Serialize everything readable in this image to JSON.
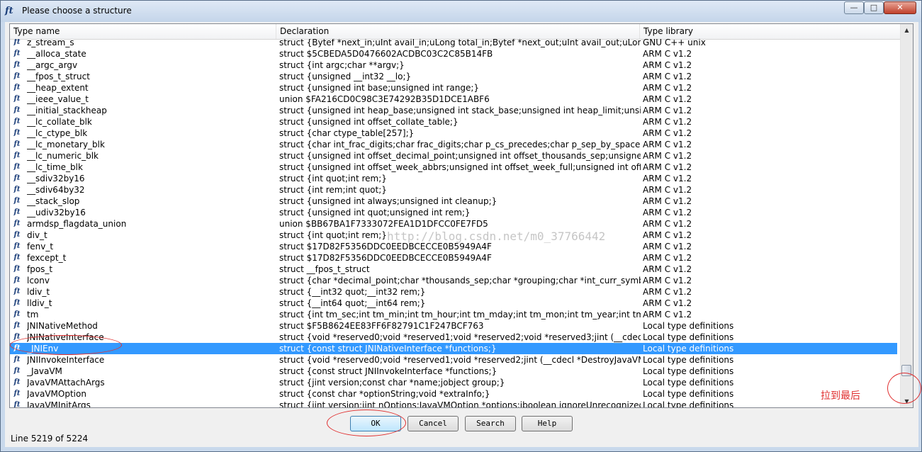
{
  "window": {
    "title": "Please choose a structure"
  },
  "columns": {
    "name": "Type name",
    "decl": "Declaration",
    "lib": "Type library"
  },
  "rows": [
    {
      "name": "z_stream_s",
      "decl": "struct {Bytef *next_in;uInt avail_in;uLong total_in;Bytef *next_out;uInt avail_out;uLong to...",
      "lib": "GNU C++ unix"
    },
    {
      "name": "__alloca_state",
      "decl": "struct $5CBEDA5D0476602ACDBC03C2C85B14FB",
      "lib": "ARM C v1.2"
    },
    {
      "name": "__argc_argv",
      "decl": "struct {int argc;char **argv;}",
      "lib": "ARM C v1.2"
    },
    {
      "name": "__fpos_t_struct",
      "decl": "struct {unsigned __int32 __lo;}",
      "lib": "ARM C v1.2"
    },
    {
      "name": "__heap_extent",
      "decl": "struct {unsigned int base;unsigned int range;}",
      "lib": "ARM C v1.2"
    },
    {
      "name": "__ieee_value_t",
      "decl": "union $FA216CD0C98C3E74292B35D1DCE1ABF6",
      "lib": "ARM C v1.2"
    },
    {
      "name": "__initial_stackheap",
      "decl": "struct {unsigned int heap_base;unsigned int stack_base;unsigned int heap_limit;unsign...",
      "lib": "ARM C v1.2"
    },
    {
      "name": "__lc_collate_blk",
      "decl": "struct {unsigned int offset_collate_table;}",
      "lib": "ARM C v1.2"
    },
    {
      "name": "__lc_ctype_blk",
      "decl": "struct {char ctype_table[257];}",
      "lib": "ARM C v1.2"
    },
    {
      "name": "__lc_monetary_blk",
      "decl": "struct {char int_frac_digits;char frac_digits;char p_cs_precedes;char p_sep_by_space;ch...",
      "lib": "ARM C v1.2"
    },
    {
      "name": "__lc_numeric_blk",
      "decl": "struct {unsigned int offset_decimal_point;unsigned int offset_thousands_sep;unsigned ...",
      "lib": "ARM C v1.2"
    },
    {
      "name": "__lc_time_blk",
      "decl": "struct {unsigned int offset_week_abbrs;unsigned int offset_week_full;unsigned int offs...",
      "lib": "ARM C v1.2"
    },
    {
      "name": "__sdiv32by16",
      "decl": "struct {int quot;int rem;}",
      "lib": "ARM C v1.2"
    },
    {
      "name": "__sdiv64by32",
      "decl": "struct {int rem;int quot;}",
      "lib": "ARM C v1.2"
    },
    {
      "name": "__stack_slop",
      "decl": "struct {unsigned int always;unsigned int cleanup;}",
      "lib": "ARM C v1.2"
    },
    {
      "name": "__udiv32by16",
      "decl": "struct {unsigned int quot;unsigned int rem;}",
      "lib": "ARM C v1.2"
    },
    {
      "name": "armdsp_flagdata_union",
      "decl": "union $BB67BA1F7333072FEA1D1DFCC0FE7FD5",
      "lib": "ARM C v1.2"
    },
    {
      "name": "div_t",
      "decl": "struct {int quot;int rem;}",
      "lib": "ARM C v1.2"
    },
    {
      "name": "fenv_t",
      "decl": "struct $17D82F5356DDC0EEDBCECCE0B5949A4F",
      "lib": "ARM C v1.2"
    },
    {
      "name": "fexcept_t",
      "decl": "struct $17D82F5356DDC0EEDBCECCE0B5949A4F",
      "lib": "ARM C v1.2"
    },
    {
      "name": "fpos_t",
      "decl": "struct __fpos_t_struct",
      "lib": "ARM C v1.2"
    },
    {
      "name": "lconv",
      "decl": "struct {char *decimal_point;char *thousands_sep;char *grouping;char *int_curr_symbol;...",
      "lib": "ARM C v1.2"
    },
    {
      "name": "ldiv_t",
      "decl": "struct {__int32 quot;__int32 rem;}",
      "lib": "ARM C v1.2"
    },
    {
      "name": "lldiv_t",
      "decl": "struct {__int64 quot;__int64 rem;}",
      "lib": "ARM C v1.2"
    },
    {
      "name": "tm",
      "decl": "struct {int tm_sec;int tm_min;int tm_hour;int tm_mday;int tm_mon;int tm_year;int tm_wd...",
      "lib": "ARM C v1.2"
    },
    {
      "name": "JNINativeMethod",
      "decl": "struct $F5B8624EE83FF6F82791C1F247BCF763",
      "lib": "Local type definitions"
    },
    {
      "name": "JNINativeInterface",
      "decl": "struct {void *reserved0;void *reserved1;void *reserved2;void *reserved3;jint (__cdecl ...",
      "lib": "Local type definitions"
    },
    {
      "name": "_JNIEnv",
      "decl": "struct {const struct JNINativeInterface *functions;}",
      "lib": "Local type definitions",
      "selected": true
    },
    {
      "name": "JNIInvokeInterface",
      "decl": "struct {void *reserved0;void *reserved1;void *reserved2;jint (__cdecl *DestroyJavaVM)...",
      "lib": "Local type definitions"
    },
    {
      "name": "_JavaVM",
      "decl": "struct {const struct JNIInvokeInterface *functions;}",
      "lib": "Local type definitions"
    },
    {
      "name": "JavaVMAttachArgs",
      "decl": "struct {jint version;const char *name;jobject group;}",
      "lib": "Local type definitions"
    },
    {
      "name": "JavaVMOption",
      "decl": "struct {const char *optionString;void *extraInfo;}",
      "lib": "Local type definitions"
    },
    {
      "name": "JavaVMInitArgs",
      "decl": "struct {jint version;jint nOptions;JavaVMOption *options;jboolean ignoreUnrecognized;}",
      "lib": "Local type definitions"
    }
  ],
  "buttons": {
    "ok": "OK",
    "cancel": "Cancel",
    "search": "Search",
    "help": "Help"
  },
  "status": "Line 5219 of 5224",
  "watermark": "http://blog.csdn.net/m0_37766442",
  "annotation": "拉到最后",
  "colors": {
    "selection": "#3399ff",
    "annotation": "#e03030"
  }
}
